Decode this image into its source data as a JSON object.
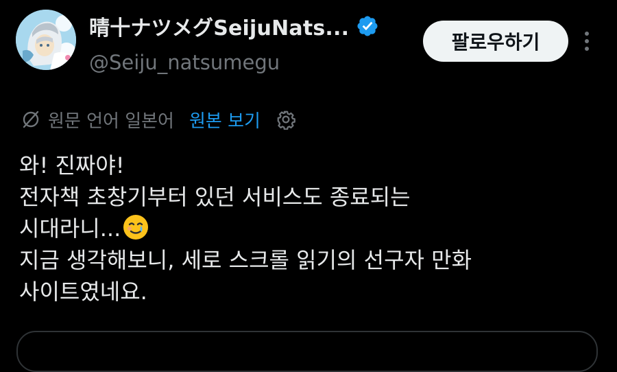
{
  "author": {
    "display_name": "晴十ナツメグSeijuNats...",
    "handle": "@Seiju_natsumegu",
    "verified": true,
    "avatar": "anime-character-avatar"
  },
  "actions": {
    "follow_label": "팔로우하기",
    "more_icon": "more-dots-icon"
  },
  "translation": {
    "icon": "globe-translate-icon",
    "label": "원문 언어 일본어",
    "link": "원본 보기",
    "settings_icon": "gear-icon"
  },
  "tweet": {
    "lines": [
      "와! 진짜야!",
      "전자책 초창기부터 있던 서비스도 종료되는",
      "시대라니...",
      "지금 생각해보니, 세로 스크롤 읽기의 선구자 만화",
      "사이트였네요."
    ],
    "emoji": "face-holding-back-tears-emoji"
  },
  "colors": {
    "background": "#000000",
    "text": "#e7e9ea",
    "muted": "#71767b",
    "link": "#1d9bf0",
    "verified": "#1d9bf0",
    "follow_bg": "#eff3f4"
  }
}
